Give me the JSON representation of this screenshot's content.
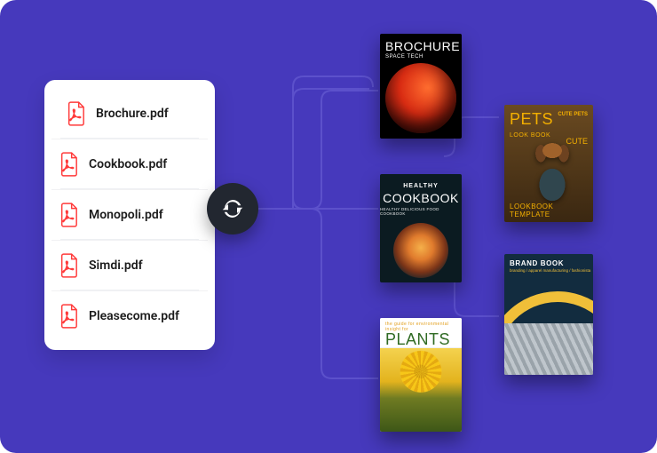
{
  "files": [
    {
      "name": "Brochure.pdf"
    },
    {
      "name": "Cookbook.pdf"
    },
    {
      "name": "Monopoli.pdf"
    },
    {
      "name": "Simdi.pdf"
    },
    {
      "name": "Pleasecome.pdf"
    }
  ],
  "covers": {
    "brochure": {
      "title": "BROCHURE",
      "subtitle": "SPACE TECH"
    },
    "cookbook": {
      "pre": "HEALTHY",
      "title": "COOKBOOK",
      "subtitle": "HEALTHY DELICIOUS FOOD COOKBOOK"
    },
    "plants": {
      "tag": "the guide for environmental insight for",
      "title": "PLANTS"
    },
    "pets": {
      "title": "PETS",
      "tag": "CUTE PETS",
      "lookbook": "LOOK BOOK",
      "cute": "CUTE",
      "footer": "LOOKBOOK TEMPLATE"
    },
    "brand": {
      "title": "BRAND BOOK",
      "strip": "branding / apparel manufacturing / fashionista"
    }
  }
}
